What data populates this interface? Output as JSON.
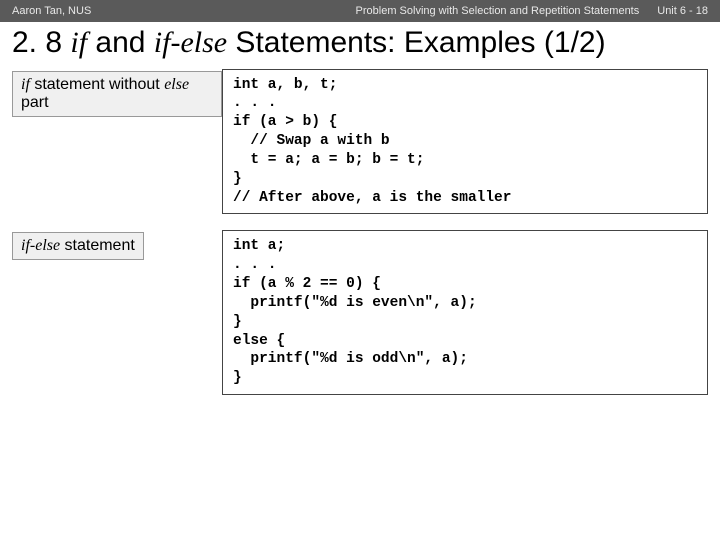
{
  "topbar": {
    "author": "Aaron Tan, NUS",
    "course": "Problem Solving with Selection and Repetition Statements",
    "unit": "Unit 6 - 18"
  },
  "title": {
    "prefix": "2. 8 ",
    "it1": "if",
    "mid1": " and ",
    "it2": "if-else",
    "suffix": " Statements: Examples (1/2)"
  },
  "rows": [
    {
      "label": {
        "parts": [
          {
            "text": "if",
            "italic": true
          },
          {
            "text": " statement without ",
            "italic": false
          },
          {
            "text": "else",
            "italic": true
          },
          {
            "text": " part",
            "italic": false
          }
        ]
      },
      "code": "int a, b, t;\n. . .\nif (a > b) {\n  // Swap a with b\n  t = a; a = b; b = t;\n}\n// After above, a is the smaller"
    },
    {
      "label": {
        "parts": [
          {
            "text": "if-else",
            "italic": true
          },
          {
            "text": " statement",
            "italic": false
          }
        ]
      },
      "code": "int a;\n. . .\nif (a % 2 == 0) {\n  printf(\"%d is even\\n\", a);\n}\nelse {\n  printf(\"%d is odd\\n\", a);\n}"
    }
  ]
}
